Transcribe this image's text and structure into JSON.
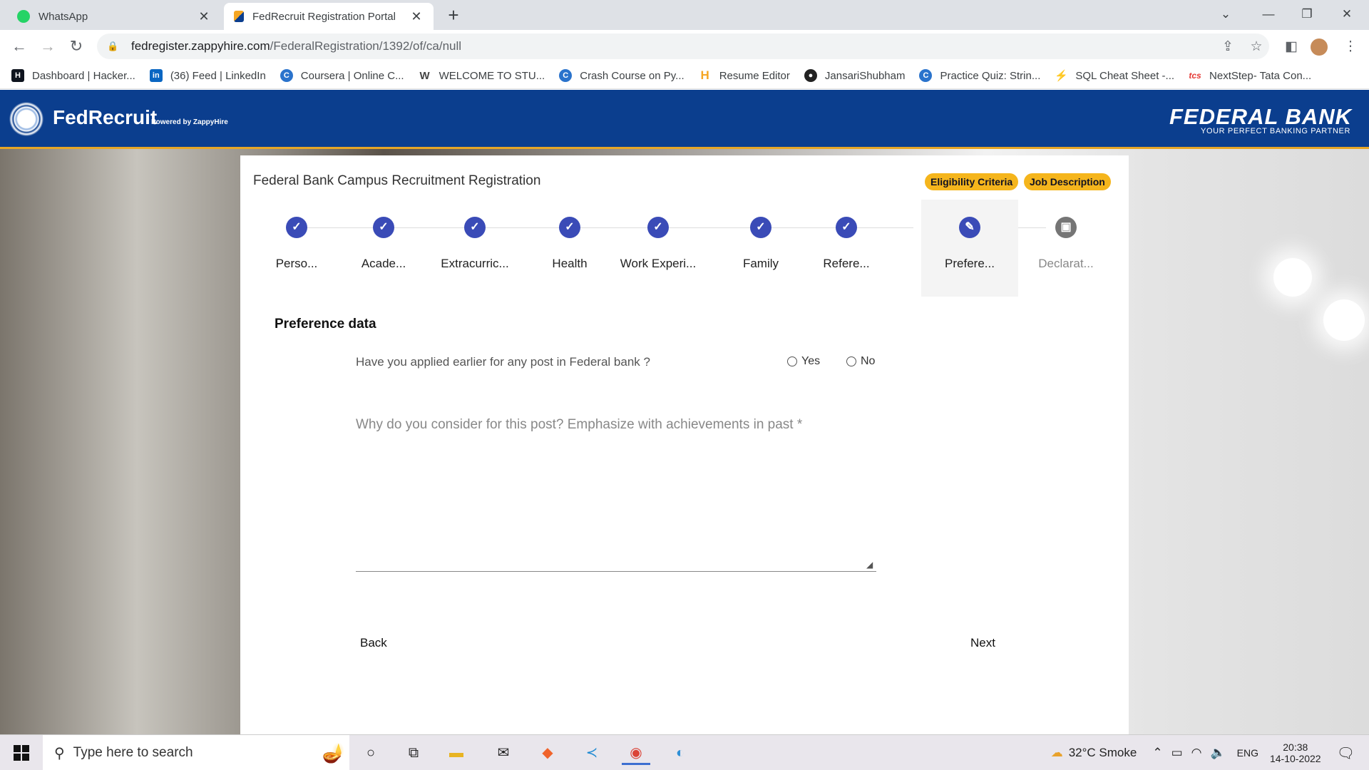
{
  "browser": {
    "tabs": [
      {
        "title": "WhatsApp",
        "icon": "whatsapp-icon",
        "active": false
      },
      {
        "title": "FedRecruit Registration Portal",
        "icon": "fedrecruit-icon",
        "active": true
      }
    ],
    "url_host": "fedregister.zappyhire.com",
    "url_path": "/FederalRegistration/1392/of/ca/null",
    "bookmarks": [
      {
        "label": "Dashboard | Hacker...",
        "icon": "hackerrank-icon",
        "color": "#0e141e"
      },
      {
        "label": "(36) Feed | LinkedIn",
        "icon": "linkedin-icon",
        "color": "#0a66c2"
      },
      {
        "label": "Coursera | Online C...",
        "icon": "coursera-icon",
        "color": "#2a73cc"
      },
      {
        "label": "WELCOME TO STU...",
        "icon": "w-icon",
        "color": "#444444"
      },
      {
        "label": "Crash Course on Py...",
        "icon": "coursera-icon",
        "color": "#2a73cc"
      },
      {
        "label": "Resume Editor",
        "icon": "h-icon",
        "color": "#f5a623"
      },
      {
        "label": "JansariShubham",
        "icon": "github-icon",
        "color": "#222222"
      },
      {
        "label": "Practice Quiz: Strin...",
        "icon": "coursera-icon",
        "color": "#2a73cc"
      },
      {
        "label": "SQL Cheat Sheet -...",
        "icon": "sql-icon",
        "color": "#e8a23b"
      },
      {
        "label": "NextStep- Tata Con...",
        "icon": "tcs-icon",
        "color": "#e53935"
      }
    ]
  },
  "app": {
    "brand": "FedRecruit",
    "brand_sub": "Powered by ZappyHire",
    "bank_logo": "FEDERAL BANK",
    "bank_tagline": "YOUR PERFECT BANKING PARTNER",
    "accent_color": "#0b3e8e",
    "chip_color": "#f5b51c"
  },
  "card": {
    "title": "Federal Bank Campus Recruitment Registration",
    "chips": [
      "Eligibility Criteria",
      "Job Description"
    ],
    "steps": [
      {
        "label": "Perso...",
        "state": "done"
      },
      {
        "label": "Acade...",
        "state": "done"
      },
      {
        "label": "Extracurric...",
        "state": "done"
      },
      {
        "label": "Health",
        "state": "done"
      },
      {
        "label": "Work Experi...",
        "state": "done"
      },
      {
        "label": "Family",
        "state": "done"
      },
      {
        "label": "Refere...",
        "state": "done"
      },
      {
        "label": "Prefere...",
        "state": "current"
      },
      {
        "label": "Declarat...",
        "state": "pending"
      }
    ],
    "section_title": "Preference data",
    "question_applied": "Have you applied earlier for any post in Federal bank ?",
    "radio_yes": "Yes",
    "radio_no": "No",
    "question_why": "Why do you consider for this post? Emphasize with achievements in past *",
    "essay_value": "",
    "back_label": "Back",
    "next_label": "Next"
  },
  "taskbar": {
    "search_placeholder": "Type here to search",
    "weather": "32°C  Smoke",
    "lang": "ENG",
    "time": "20:38",
    "date": "14-10-2022"
  }
}
